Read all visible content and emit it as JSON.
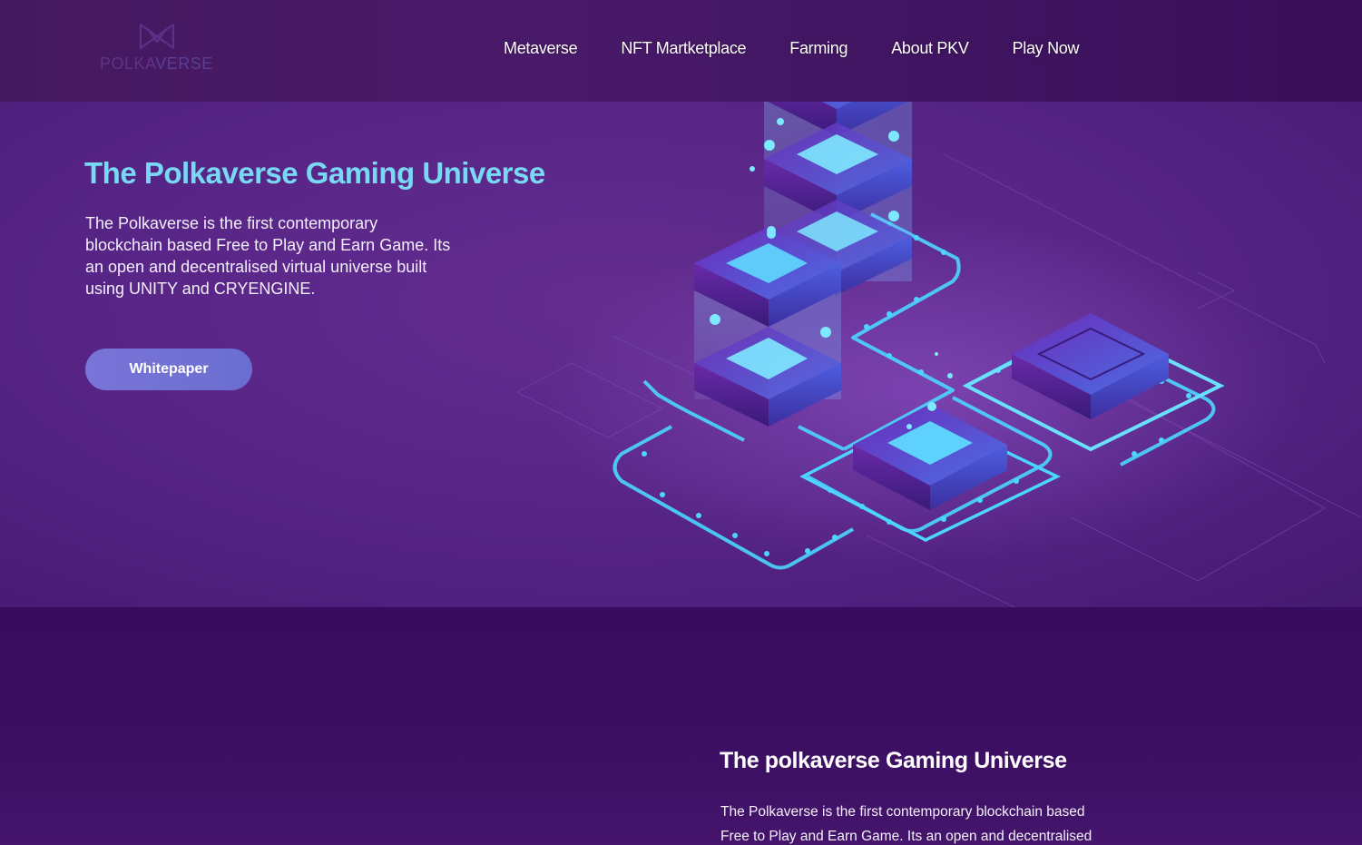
{
  "brand": {
    "logo_text_part1": "POLKA",
    "logo_text_part2": "VERSE",
    "icon": "polkaverse-logo-icon"
  },
  "nav": {
    "items": [
      {
        "label": "Metaverse"
      },
      {
        "label": "NFT Martketplace"
      },
      {
        "label": "Farming"
      },
      {
        "label": "About PKV"
      },
      {
        "label": "Play Now"
      }
    ]
  },
  "hero": {
    "title": "The Polkaverse Gaming Universe",
    "description": "The Polkaverse is the first contemporary blockchain based Free to Play and Earn Game. Its an open and decentralised virtual universe built using UNITY and CRYENGINE.",
    "button_label": "Whitepaper",
    "illustration": "isometric-blockchain-servers-illustration"
  },
  "section2": {
    "title": "The polkaverse Gaming Universe",
    "description": "The Polkaverse is the first contemporary blockchain based Free to Play and Earn Game. Its an open and decentralised"
  },
  "colors": {
    "accent_cyan": "#79d9f5",
    "button": "#7a74d8",
    "header_bg": "#45195f",
    "hero_bg": "#5a2789",
    "section_bg": "#3a0d60"
  }
}
